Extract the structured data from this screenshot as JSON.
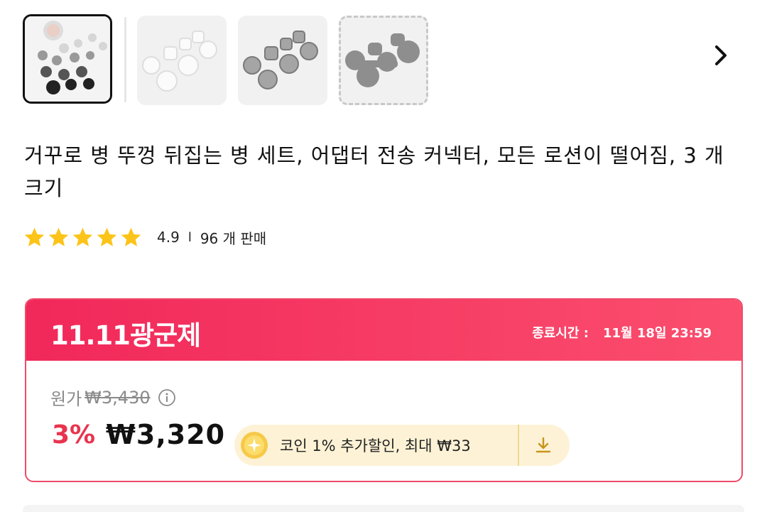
{
  "product": {
    "title": "거꾸로 병 뚜껑 뒤집는 병 세트, 어댑터 전송 커넥터, 모든 로션이 떨어짐, 3 개 크기"
  },
  "gallery": {
    "thumbnails": [
      {
        "name": "all colors set",
        "selected": true
      },
      {
        "name": "white set",
        "selected": false
      },
      {
        "name": "gray set",
        "selected": false
      },
      {
        "name": "dark gray set",
        "selected": false
      }
    ]
  },
  "rating": {
    "stars": 5,
    "score": "4.9",
    "separator": "l",
    "sold": "96 개 판매"
  },
  "promo": {
    "name": "11.11광군제",
    "end_label": "종료시간 :",
    "end_time": "11월 18일 23:59",
    "original_label": "원가",
    "original_price": "₩3,430",
    "discount": "3%",
    "price": "₩3,320",
    "coin_text": "코인 1% 추가할인, 최대 ₩33"
  },
  "colors": {
    "accent": "#f1285a",
    "star": "#fcc419",
    "coin_bg": "#fdf2d5"
  }
}
